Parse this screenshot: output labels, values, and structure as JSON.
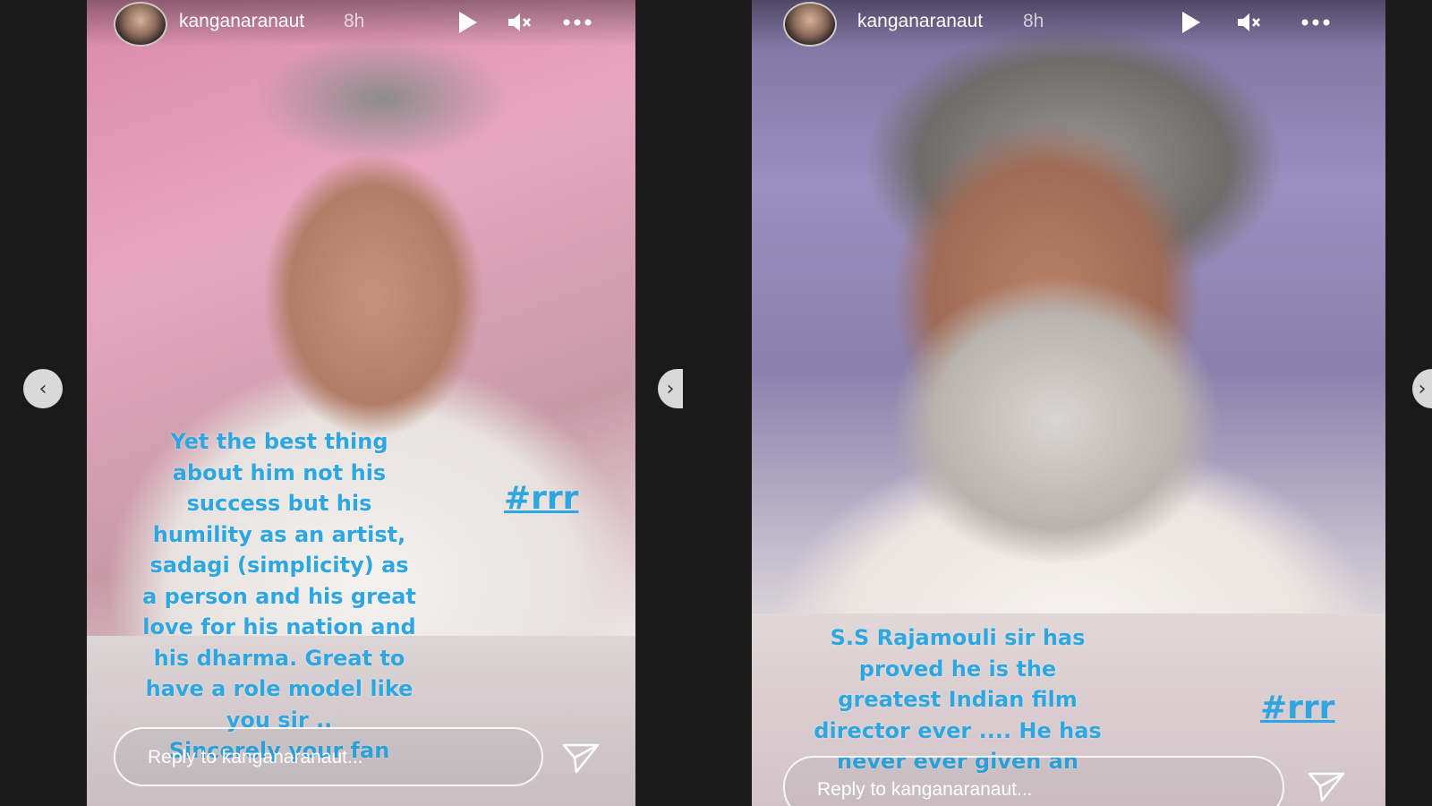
{
  "stories": [
    {
      "username": "kanganaranaut",
      "time_ago": "8h",
      "caption_lines": [
        "Yet the best thing",
        "about him not his",
        "success but his",
        "humility as an artist,",
        "sadagi (simplicity) as",
        "a person and his great",
        "love for his nation and",
        "his dharma. Great to",
        "have a role model like",
        "you  sir ..",
        "Sincerely your fan"
      ],
      "hashtag": "#rrr",
      "reply_placeholder": "Reply to kanganaranaut..."
    },
    {
      "username": "kanganaranaut",
      "time_ago": "8h",
      "caption_lines": [
        "S.S Rajamouli sir has",
        "proved he is the",
        "greatest Indian film",
        "director ever .... He has",
        "never ever given an"
      ],
      "hashtag": "#rrr",
      "reply_placeholder": "Reply to kanganaranaut..."
    }
  ],
  "icons": {
    "play": "play-icon",
    "mute": "mute-icon",
    "more": "more-icon",
    "send": "send-icon",
    "prev": "chevron-left-icon",
    "next": "chevron-right-icon"
  },
  "nav": {
    "prev_glyph": "‹",
    "next_glyph": "›"
  },
  "colors": {
    "caption": "#2ea6df",
    "background": "#1a1a1a"
  }
}
